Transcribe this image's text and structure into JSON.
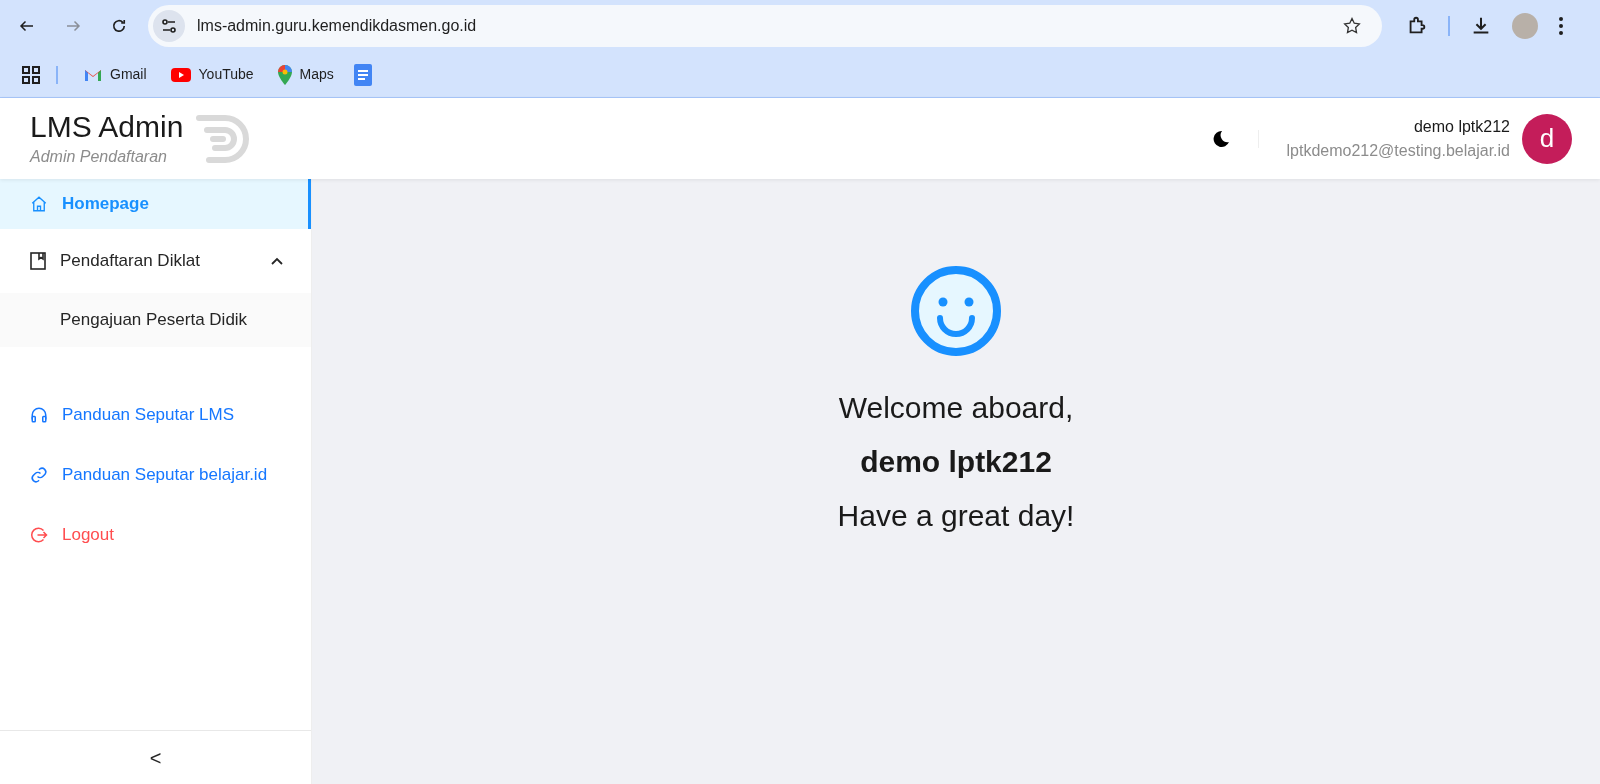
{
  "browser": {
    "url": "lms-admin.guru.kemendikdasmen.go.id",
    "bookmarks": [
      {
        "kind": "gmail",
        "label": "Gmail"
      },
      {
        "kind": "youtube",
        "label": "YouTube"
      },
      {
        "kind": "maps",
        "label": "Maps"
      },
      {
        "kind": "docs"
      }
    ]
  },
  "header": {
    "title": "LMS Admin",
    "subtitle": "Admin Pendaftaran",
    "user_name": "demo lptk212",
    "user_email": "lptkdemo212@testing.belajar.id",
    "avatar_letter": "d"
  },
  "sidebar": {
    "items": [
      {
        "kind": "menu",
        "label": "Homepage",
        "selected": true
      },
      {
        "kind": "group",
        "label": "Pendaftaran Diklat",
        "selected": false,
        "expanded": true,
        "children": [
          {
            "label": "Pengajuan Peserta Didik",
            "selected": false
          }
        ]
      },
      {
        "kind": "link",
        "label": "Panduan Seputar LMS",
        "selected": false
      },
      {
        "kind": "link",
        "label": "Panduan Seputar belajar.id",
        "selected": false
      },
      {
        "kind": "danger",
        "label": "Logout",
        "selected": false
      }
    ],
    "collapse": "<"
  },
  "welcome": {
    "greeting": "Welcome aboard,",
    "name": "demo lptk212",
    "wish": "Have a great day!"
  }
}
